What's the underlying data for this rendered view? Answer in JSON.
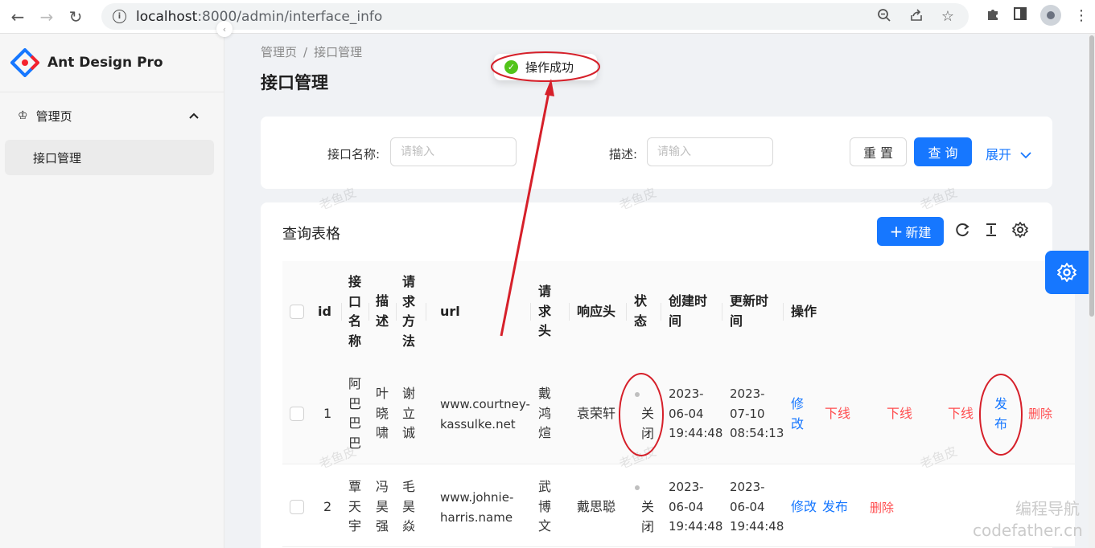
{
  "browser": {
    "url_host": "localhost",
    "url_rest": ":8000/admin/interface_info"
  },
  "sidebar": {
    "logo_text": "Ant Design Pro",
    "group_label": "管理页",
    "items": [
      {
        "label": "接口管理"
      }
    ]
  },
  "header": {
    "breadcrumb": [
      "管理页",
      "接口管理"
    ],
    "breadcrumb_sep": "/",
    "title": "接口管理"
  },
  "search": {
    "name_label": "接口名称",
    "name_placeholder": "请输入",
    "desc_label": "描述",
    "desc_placeholder": "请输入",
    "reset_label": "重 置",
    "query_label": "查 询",
    "expand_label": "展开"
  },
  "toast": {
    "message": "操作成功"
  },
  "table": {
    "title": "查询表格",
    "new_label": "新建",
    "columns": {
      "id": "id",
      "name": [
        "接",
        "口",
        "名",
        "称"
      ],
      "desc": [
        "描",
        "述"
      ],
      "method": [
        "请",
        "求",
        "方",
        "法"
      ],
      "url": "url",
      "reqheader": [
        "请",
        "求",
        "头"
      ],
      "respheader": "响应头",
      "status": [
        "状",
        "态"
      ],
      "created": [
        "创建时",
        "间"
      ],
      "updated": [
        "更新时",
        "间"
      ],
      "actions": "操作"
    },
    "rows": [
      {
        "id": "1",
        "name": [
          "阿",
          "巴",
          "巴",
          "巴"
        ],
        "desc": [
          "叶",
          "晓",
          "啸"
        ],
        "method": [
          "谢",
          "立",
          "诚"
        ],
        "url": [
          "www.courtney-",
          "kassulke.net"
        ],
        "reqheader": [
          "戴",
          "鸿",
          "煊"
        ],
        "respheader": "袁荣轩",
        "status": [
          "关",
          "闭"
        ],
        "created": [
          "2023-",
          "06-04",
          "19:44:48"
        ],
        "updated": [
          "2023-",
          "07-10",
          "08:54:13"
        ],
        "actions": {
          "edit": [
            "修",
            "改"
          ],
          "offline1": "下线",
          "offline2": "下线",
          "offline3": "下线",
          "publish": [
            "发",
            "布"
          ],
          "delete": "删除"
        }
      },
      {
        "id": "2",
        "name": [
          "覃",
          "天",
          "宇"
        ],
        "desc": [
          "冯",
          "昊",
          "强"
        ],
        "method": [
          "毛",
          "昊",
          "焱"
        ],
        "url": [
          "www.johnie-",
          "harris.name"
        ],
        "reqheader": [
          "武",
          "博",
          "文"
        ],
        "respheader": "戴思聪",
        "status": [
          "关",
          "闭"
        ],
        "created": [
          "2023-",
          "06-04",
          "19:44:48"
        ],
        "updated": [
          "2023-",
          "06-04",
          "19:44:48"
        ],
        "actions": {
          "edit": "修改",
          "publish": "发布",
          "delete": "删除"
        }
      }
    ]
  },
  "watermark": {
    "text": "老鱼皮"
  },
  "overlay": {
    "brand": "编程导航",
    "site": "codefather.cn"
  },
  "colors": {
    "primary": "#1677ff",
    "danger": "#ff4d4f",
    "success": "#52c41a",
    "annotation": "#d6202a"
  }
}
